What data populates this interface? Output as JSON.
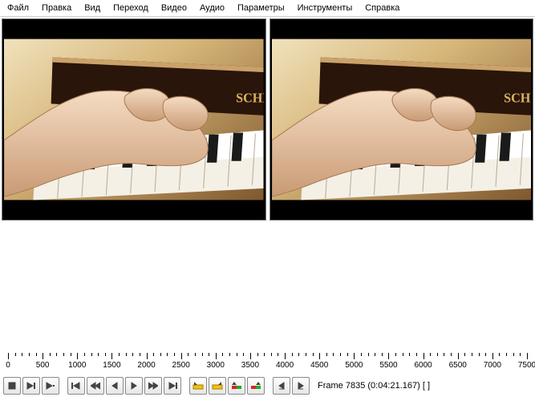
{
  "menu": {
    "items": [
      "Файл",
      "Правка",
      "Вид",
      "Переход",
      "Видео",
      "Аудио",
      "Параметры",
      "Инструменты",
      "Справка"
    ]
  },
  "timeline": {
    "min": 0,
    "max": 7500,
    "step": 500,
    "ticks": [
      0,
      500,
      1000,
      1500,
      2000,
      2500,
      3000,
      3500,
      4000,
      4500,
      5000,
      5500,
      6000,
      6500,
      7000,
      7500
    ]
  },
  "status": {
    "frame_text": "Frame 7835 (0:04:21.167) [ ]",
    "frame_number": 7835,
    "timecode": "0:04:21.167"
  },
  "controls": {
    "btn_stop": "stop",
    "btn_play_in": "play-in",
    "btn_play_out": "play-out",
    "btn_goto_start": "go-to-start",
    "btn_step_back": "step-back",
    "btn_key_prev": "key-prev",
    "btn_key_next": "key-next",
    "btn_step_fwd": "step-forward",
    "btn_goto_end": "go-to-end",
    "btn_mark_in": "mark-in",
    "btn_mark_out": "mark-out",
    "btn_scene_prev": "scene-prev",
    "btn_scene_next": "scene-next",
    "btn_shuttle_back": "shuttle-back",
    "btn_shuttle_fwd": "shuttle-forward"
  }
}
